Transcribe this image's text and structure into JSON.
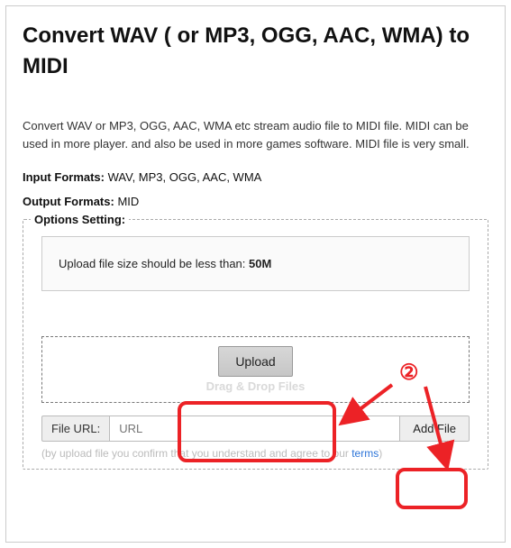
{
  "title": "Convert WAV ( or MP3, OGG, AAC, WMA) to MIDI",
  "description": "Convert WAV or MP3, OGG, AAC, WMA etc stream audio file to MIDI file. MIDI can be used in more player. and also be used in more games software. MIDI file is very small.",
  "input_formats_label": "Input Formats:",
  "input_formats_value": " WAV, MP3, OGG, AAC, WMA",
  "output_formats_label": "Output Formats:",
  "output_formats_value": " MID",
  "options_legend": "Options Setting:",
  "notice_prefix": "Upload file size should be less than: ",
  "notice_value": "50M",
  "upload_button": "Upload",
  "drag_text": "Drag & Drop Files",
  "file_url_label": "File URL:",
  "url_placeholder": "URL",
  "add_file_button": "Add File",
  "disclaimer_text": "(by upload file you confirm that you understand and agree to our ",
  "terms_link": "terms",
  "disclaimer_suffix": ")",
  "annotation_step": "②",
  "colors": {
    "annotation_red": "#ec2226",
    "link_blue": "#2b74d8"
  }
}
